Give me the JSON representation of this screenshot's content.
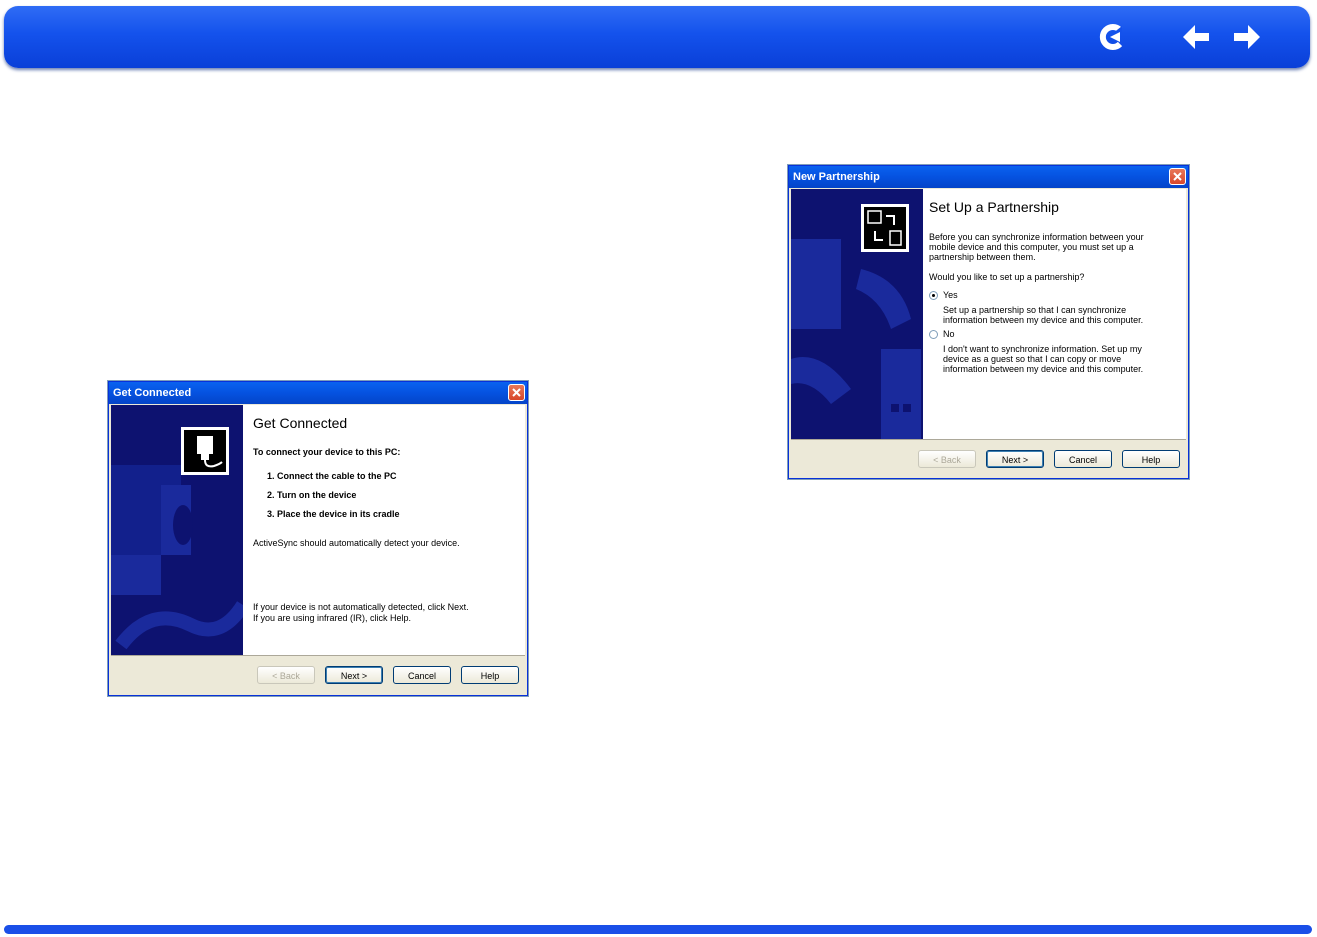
{
  "nav": {
    "icons": [
      "return-icon",
      "previous-page-icon",
      "next-page-icon"
    ]
  },
  "dialog_connected": {
    "title": "Get Connected",
    "heading": "Get Connected",
    "intro": "To connect your device to this PC:",
    "steps": [
      "1. Connect the cable to the PC",
      "2. Turn on the device",
      "3. Place the device in its cradle"
    ],
    "auto_detect": "ActiveSync should automatically detect your device.",
    "footnote_1": "If your device is not automatically detected, click Next.",
    "footnote_2": "If you are using infrared (IR), click Help.",
    "buttons": {
      "back": "< Back",
      "next": "Next >",
      "cancel": "Cancel",
      "help": "Help"
    }
  },
  "dialog_partnership": {
    "title": "New Partnership",
    "heading": "Set Up a Partnership",
    "intro_1": "Before you can synchronize information between your",
    "intro_2": "mobile device and this computer, you must set up a",
    "intro_3": "partnership between them.",
    "question": "Would you like to set up a partnership?",
    "yes_label": "Yes",
    "yes_desc_1": "Set up a partnership so that I can synchronize",
    "yes_desc_2": "information between my device and this computer.",
    "no_label": "No",
    "no_desc_1": "I don't want to synchronize information. Set up my",
    "no_desc_2": "device as a guest so that I can copy or move",
    "no_desc_3": "information between my device and this computer.",
    "selected": "Yes",
    "buttons": {
      "back": "< Back",
      "next": "Next >",
      "cancel": "Cancel",
      "help": "Help"
    }
  },
  "colors": {
    "nav_blue": "#1452ec",
    "dialog_title_blue": "#0552e0",
    "side_panel": "#0d1270"
  }
}
